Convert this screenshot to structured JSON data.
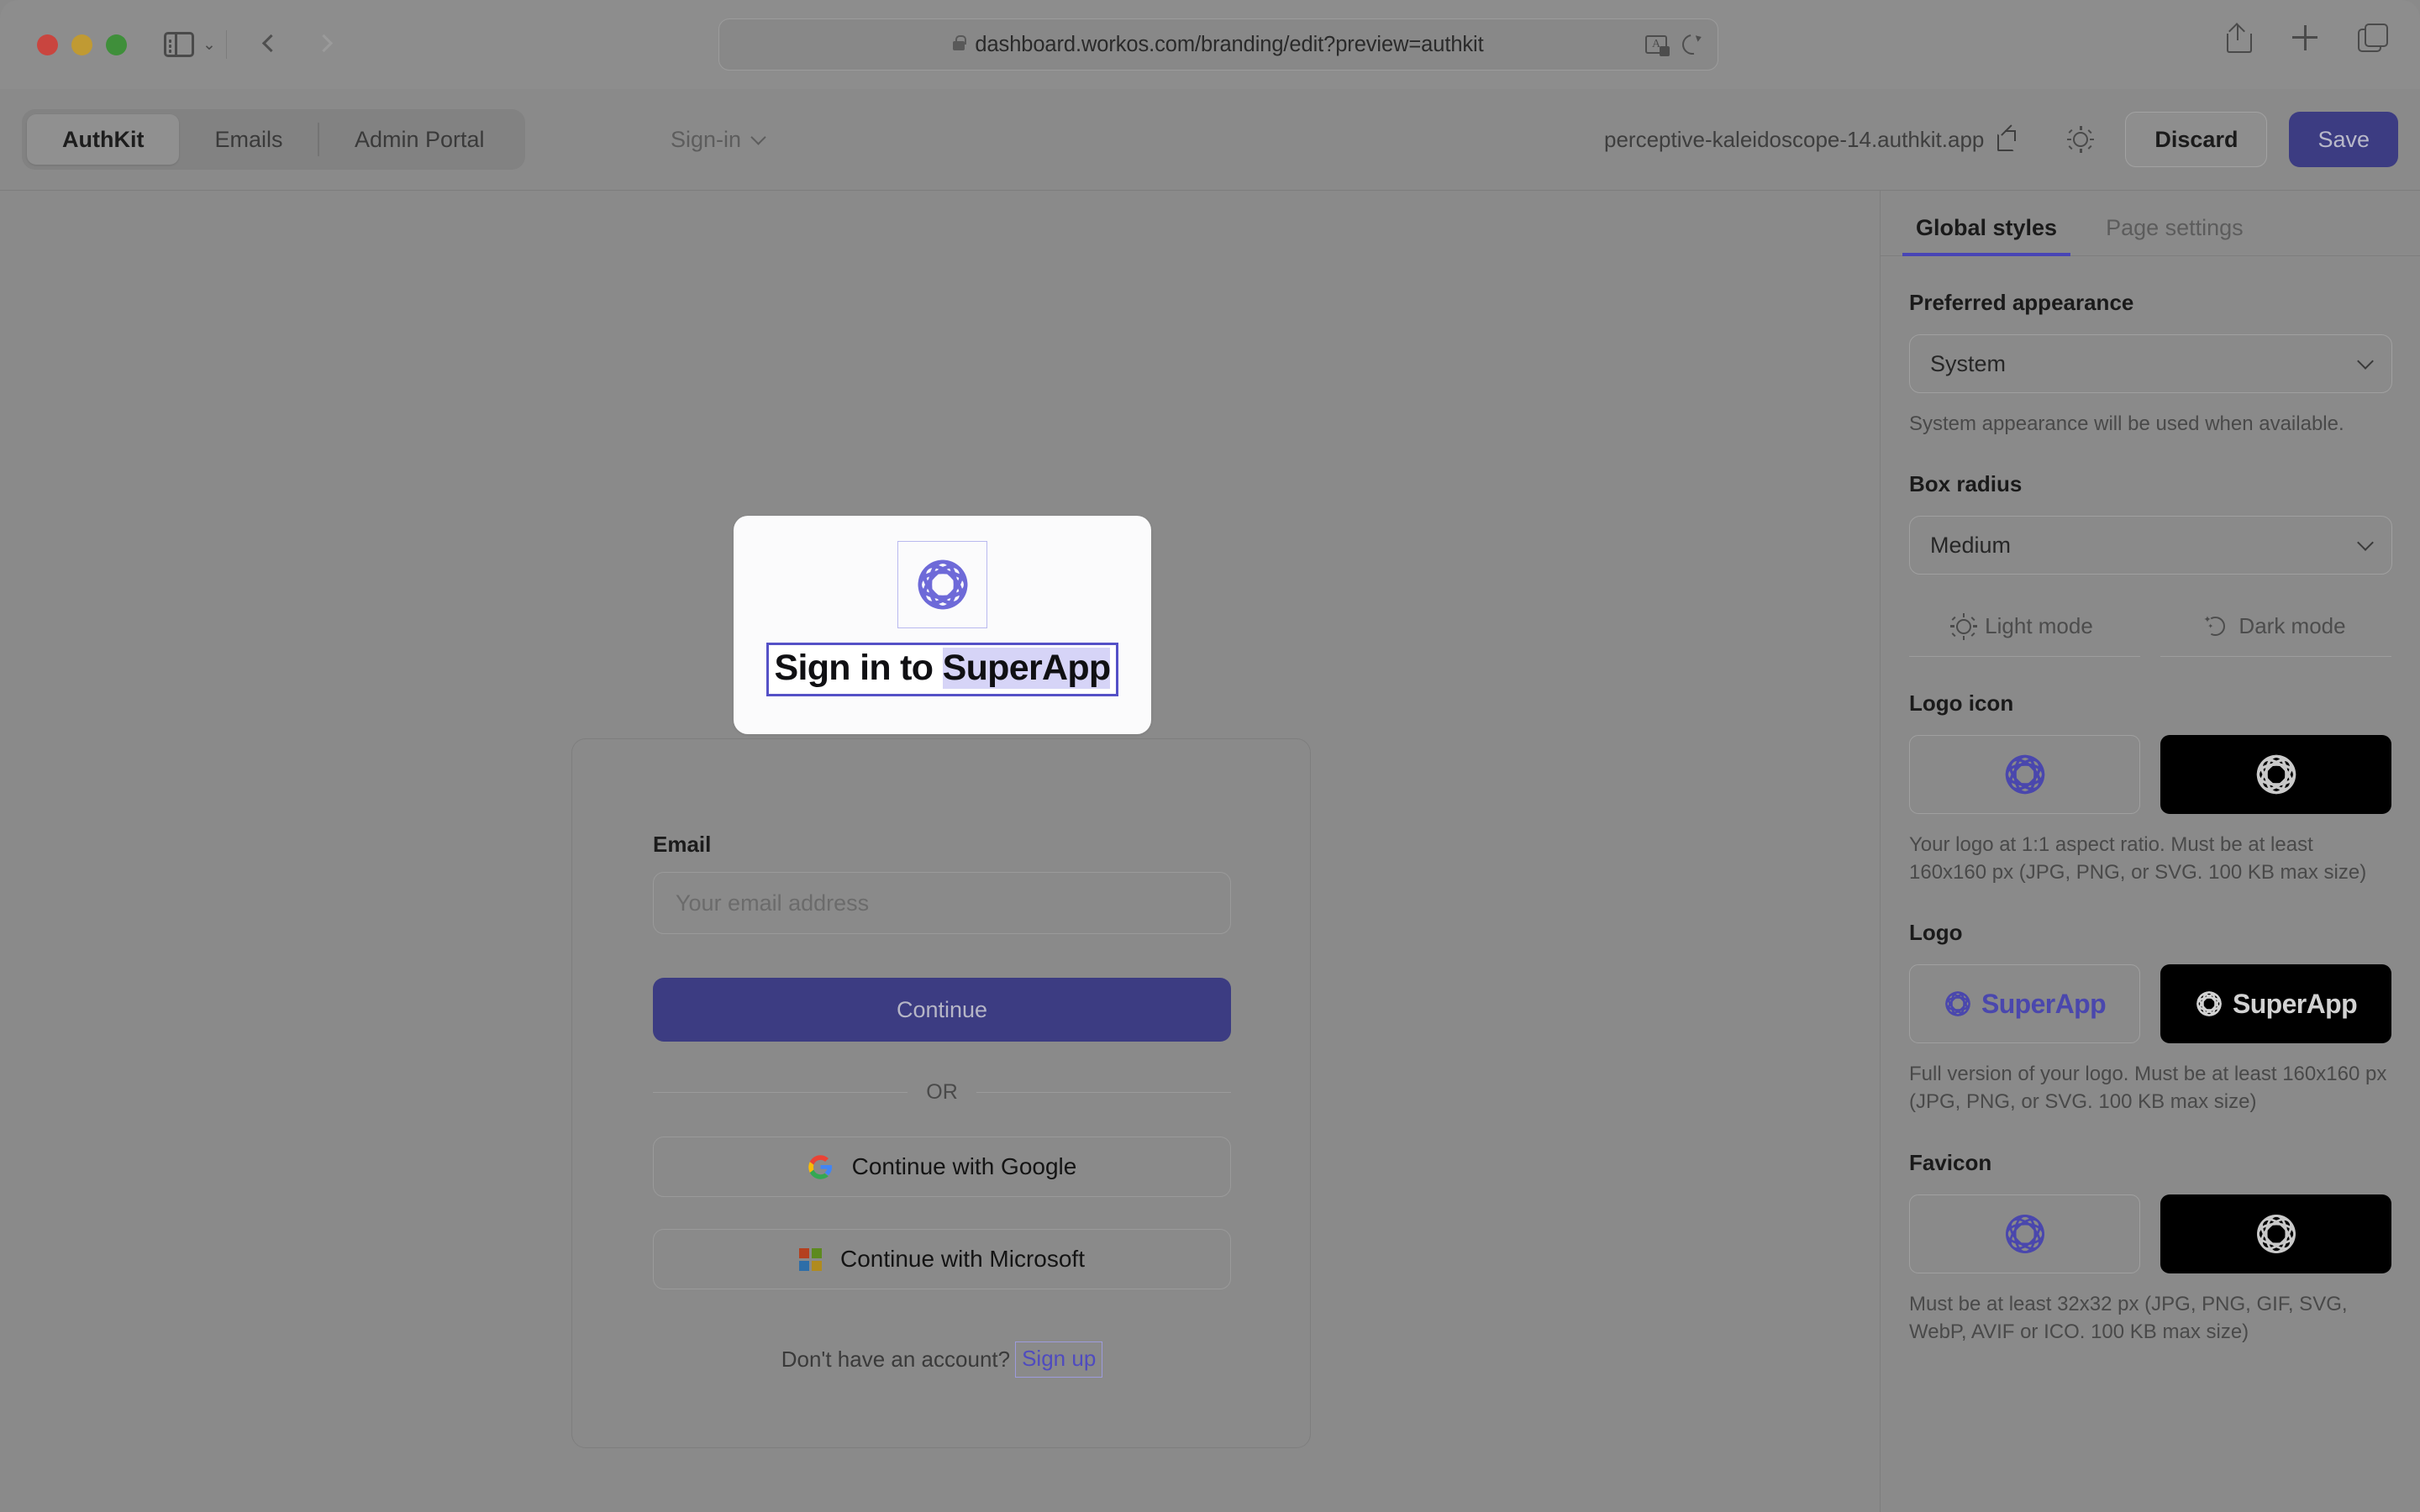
{
  "browser": {
    "url": "dashboard.workos.com/branding/edit?preview=authkit",
    "lock_icon": "lock-icon",
    "back_icon": "back-arrow-icon",
    "forward_icon": "forward-arrow-icon",
    "sidebar_icon": "sidebar-toggle-icon",
    "translate_icon": "translate-icon",
    "reload_icon": "reload-icon",
    "share_icon": "share-icon",
    "new_tab_icon": "plus-icon",
    "tab_overview_icon": "tab-overview-icon"
  },
  "toolbar": {
    "segments": [
      {
        "label": "AuthKit",
        "active": true
      },
      {
        "label": "Emails",
        "active": false
      },
      {
        "label": "Admin Portal",
        "active": false
      }
    ],
    "page_selector": {
      "label": "Sign-in",
      "icon": "chevron-down-icon"
    },
    "preview_url": "perceptive-kaleidoscope-14.authkit.app",
    "external_link_icon": "external-link-icon",
    "theme_toggle_icon": "sun-icon",
    "discard_label": "Discard",
    "save_label": "Save"
  },
  "preview": {
    "logo_icon": "superapp-logo-icon",
    "title_prefix": "Sign in to ",
    "title_brand": "SuperApp",
    "email_label": "Email",
    "email_value": "",
    "email_placeholder": "Your email address",
    "continue_label": "Continue",
    "divider_label": "OR",
    "oauth": [
      {
        "label": "Continue with Google",
        "icon": "google-icon"
      },
      {
        "label": "Continue with Microsoft",
        "icon": "microsoft-icon"
      }
    ],
    "footer_text": "Don't have an account?",
    "footer_link": "Sign up"
  },
  "panel": {
    "tabs": [
      {
        "label": "Global styles",
        "active": true
      },
      {
        "label": "Page settings",
        "active": false
      }
    ],
    "appearance": {
      "heading": "Preferred appearance",
      "value": "System",
      "hint": "System appearance will be used when available.",
      "chevron_icon": "chevron-down-icon"
    },
    "box_radius": {
      "heading": "Box radius",
      "value": "Medium",
      "chevron_icon": "chevron-down-icon"
    },
    "modes": [
      {
        "label": "Light mode",
        "icon": "sun-icon",
        "active": true
      },
      {
        "label": "Dark mode",
        "icon": "moon-icon",
        "active": false
      }
    ],
    "logo_icon_section": {
      "heading": "Logo icon",
      "hint": "Your logo at 1:1 aspect ratio. Must be at least 160x160 px (JPG, PNG, or SVG. 100 KB max size)"
    },
    "logo_section": {
      "heading": "Logo",
      "wordmark": "SuperApp",
      "hint": "Full version of your logo. Must be at least 160x160 px (JPG, PNG, or SVG. 100 KB max size)"
    },
    "favicon_section": {
      "heading": "Favicon",
      "hint": "Must be at least 32x32 px (JPG, PNG, GIF, SVG, WebP, AVIF or ICO. 100 KB max size)"
    }
  },
  "colors": {
    "brand_indigo": "#3c3c82",
    "logo_purple": "#4a47ad",
    "preview_logo_purple": "#6e6ad8",
    "accent_tab": "#4845b5",
    "link_purple": "#4f4bbf",
    "highlight_lavender": "#d6d4f7",
    "overlay_grey": "#8a8a8a"
  }
}
